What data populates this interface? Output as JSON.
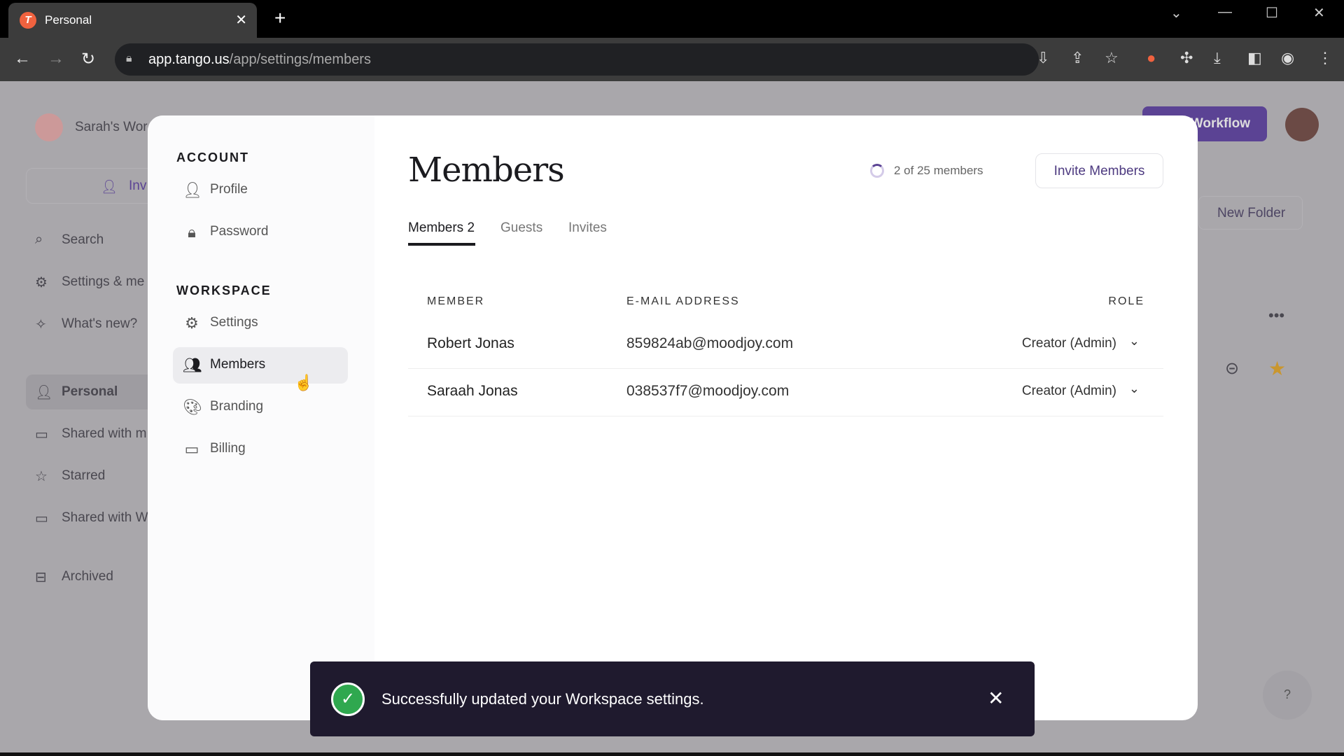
{
  "browser": {
    "tab_title": "Personal",
    "url_host": "app.tango.us",
    "url_path": "/app/settings/members"
  },
  "background": {
    "workspace_name": "Sarah's Wor",
    "invite_label": "Inv",
    "nav": [
      {
        "label": "Search",
        "icon": "search-icon"
      },
      {
        "label": "Settings & me",
        "icon": "gear-icon"
      },
      {
        "label": "What's new?",
        "icon": "sparkle-icon"
      },
      {
        "label": "Personal",
        "icon": "person-icon"
      },
      {
        "label": "Shared with m",
        "icon": "folder-icon"
      },
      {
        "label": "Starred",
        "icon": "star-icon"
      },
      {
        "label": "Shared with W",
        "icon": "folder-icon"
      },
      {
        "label": "Archived",
        "icon": "archive-icon"
      }
    ],
    "workflow_button": "Workflow",
    "new_folder_button": "New Folder"
  },
  "modal": {
    "sidebar": {
      "account_heading": "ACCOUNT",
      "account_items": [
        {
          "label": "Profile"
        },
        {
          "label": "Password"
        }
      ],
      "workspace_heading": "WORKSPACE",
      "workspace_items": [
        {
          "label": "Settings"
        },
        {
          "label": "Members",
          "active": true
        },
        {
          "label": "Branding"
        },
        {
          "label": "Billing"
        }
      ]
    },
    "title": "Members",
    "member_count": "2 of 25 members",
    "member_usage_fraction": 0.08,
    "invite_button": "Invite Members",
    "tabs": [
      {
        "label": "Members 2",
        "active": true
      },
      {
        "label": "Guests"
      },
      {
        "label": "Invites"
      }
    ],
    "table": {
      "headers": [
        "MEMBER",
        "E-MAIL ADDRESS",
        "ROLE"
      ],
      "rows": [
        {
          "name": "Robert Jonas",
          "email": "859824ab@moodjoy.com",
          "role": "Creator (Admin)"
        },
        {
          "name": "Saraah Jonas",
          "email": "038537f7@moodjoy.com",
          "role": "Creator (Admin)"
        }
      ]
    }
  },
  "toast": {
    "message": "Successfully updated your Workspace settings."
  },
  "colors": {
    "accent": "#5b4394",
    "success": "#2fa84f",
    "toast_bg": "#1f1a2e"
  }
}
